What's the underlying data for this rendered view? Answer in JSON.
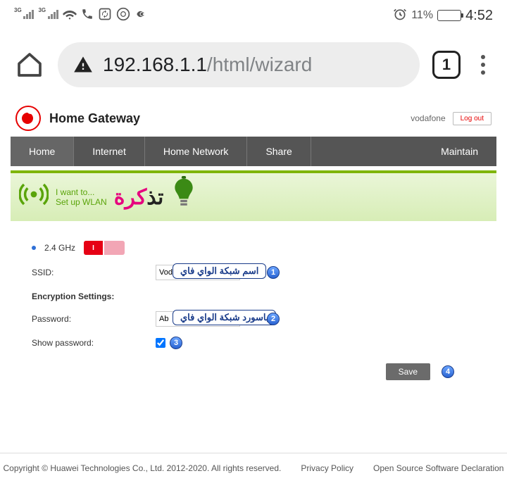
{
  "status": {
    "net_gen": "3G",
    "battery_pct": "11%",
    "clock": "4:52"
  },
  "browser": {
    "url_main": "192.168.1.1",
    "url_path": "/html/wizard",
    "tab_count": "1"
  },
  "header": {
    "title": "Home Gateway",
    "user": "vodafone",
    "logout": "Log out"
  },
  "nav": {
    "home": "Home",
    "internet": "Internet",
    "home_network": "Home Network",
    "share": "Share",
    "maintain": "Maintain"
  },
  "strip": {
    "line1": "I want to...",
    "line2": "Set up WLAN"
  },
  "form": {
    "freq": "2.4 GHz",
    "switch": "I",
    "ssid_label": "SSID:",
    "ssid_value": "Vod",
    "enc_head": "Encryption Settings:",
    "pwd_label": "Password:",
    "pwd_value": "Ab",
    "show_label": "Show password:",
    "save": "Save"
  },
  "annotations": {
    "a1": "اسم شبكة الواي فاي",
    "a2": "باسورد شبكة الواي فاي"
  },
  "footer": {
    "copyright": "Copyright © Huawei Technologies Co., Ltd. 2012-2020. All rights reserved.",
    "privacy": "Privacy Policy",
    "oss": "Open Source Software Declaration"
  }
}
